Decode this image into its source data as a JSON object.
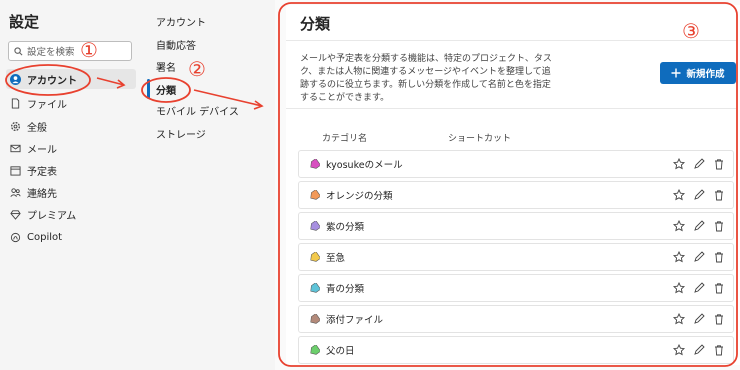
{
  "settings": {
    "title": "設定",
    "search_placeholder": "設定を検索"
  },
  "nav": [
    {
      "label": "アカウント",
      "icon": "person-icon",
      "active": true
    },
    {
      "label": "ファイル",
      "icon": "file-icon",
      "active": false
    },
    {
      "label": "全般",
      "icon": "gear-icon",
      "active": false
    },
    {
      "label": "メール",
      "icon": "mail-icon",
      "active": false
    },
    {
      "label": "予定表",
      "icon": "calendar-icon",
      "active": false
    },
    {
      "label": "連絡先",
      "icon": "people-icon",
      "active": false
    },
    {
      "label": "プレミアム",
      "icon": "diamond-icon",
      "active": false
    },
    {
      "label": "Copilot",
      "icon": "copilot-icon",
      "active": false
    }
  ],
  "subnav": [
    {
      "label": "アカウント",
      "active": false
    },
    {
      "label": "自動応答",
      "active": false
    },
    {
      "label": "署名",
      "active": false
    },
    {
      "label": "分類",
      "active": true
    },
    {
      "label": "モバイル デバイス",
      "active": false
    },
    {
      "label": "ストレージ",
      "active": false
    }
  ],
  "main": {
    "title": "分類",
    "description": "メールや予定表を分類する機能は、特定のプロジェクト、タスク、または人物に関連するメッセージやイベントを整理して追跡するのに役立ちます。新しい分類を作成して名前と色を指定することができます。",
    "new_button": "新規作成",
    "columns": {
      "name": "カテゴリ名",
      "shortcut": "ショートカット"
    },
    "categories": [
      {
        "name": "kyosukeのメール",
        "color": "#d84fc0"
      },
      {
        "name": "オレンジの分類",
        "color": "#f29a5a"
      },
      {
        "name": "紫の分類",
        "color": "#a78fe0"
      },
      {
        "name": "至急",
        "color": "#f2c94c"
      },
      {
        "name": "青の分類",
        "color": "#5ec3d8"
      },
      {
        "name": "添付ファイル",
        "color": "#b38a7a"
      },
      {
        "name": "父の日",
        "color": "#6ccf6c"
      }
    ]
  },
  "annotations": {
    "mark1": "①",
    "mark2": "②",
    "mark3": "③",
    "color": "#e8412f"
  },
  "accent_color": "#0f6cbd"
}
